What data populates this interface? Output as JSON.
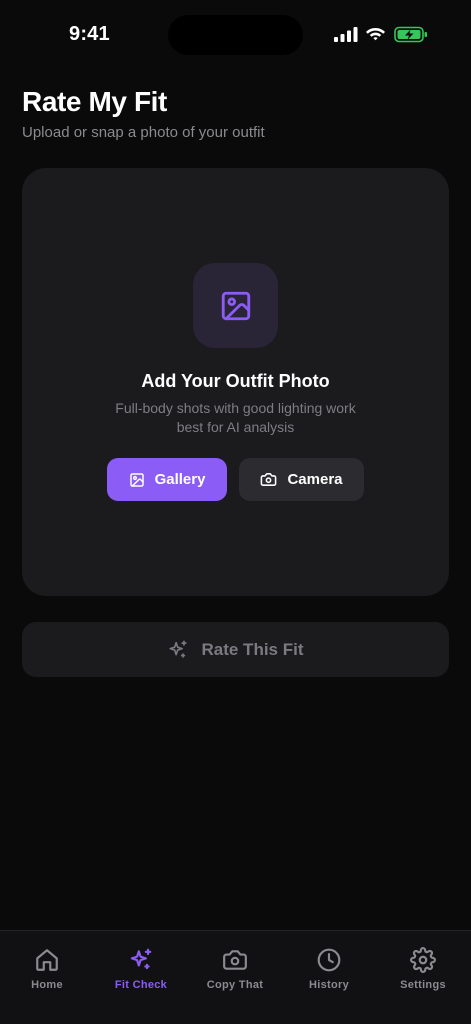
{
  "status_bar": {
    "time": "9:41"
  },
  "header": {
    "title": "Rate My Fit",
    "subtitle": "Upload or snap a photo of your outfit"
  },
  "upload_card": {
    "icon": "image-icon",
    "title": "Add Your Outfit Photo",
    "description": "Full-body shots with good lighting work best for AI analysis",
    "gallery_label": "Gallery",
    "camera_label": "Camera"
  },
  "rate_button": {
    "label": "Rate This Fit",
    "icon": "sparkles-icon"
  },
  "tab_bar": {
    "active": "Fit Check",
    "tabs": [
      {
        "label": "Home",
        "icon": "home-icon"
      },
      {
        "label": "Fit Check",
        "icon": "sparkles-icon"
      },
      {
        "label": "Copy That",
        "icon": "camera-icon"
      },
      {
        "label": "History",
        "icon": "clock-icon"
      },
      {
        "label": "Settings",
        "icon": "gear-icon"
      }
    ]
  },
  "colors": {
    "accent": "#8b5cf6",
    "background": "#0a0a0b",
    "card": "#1b1b1e",
    "battery": "#34c759"
  }
}
